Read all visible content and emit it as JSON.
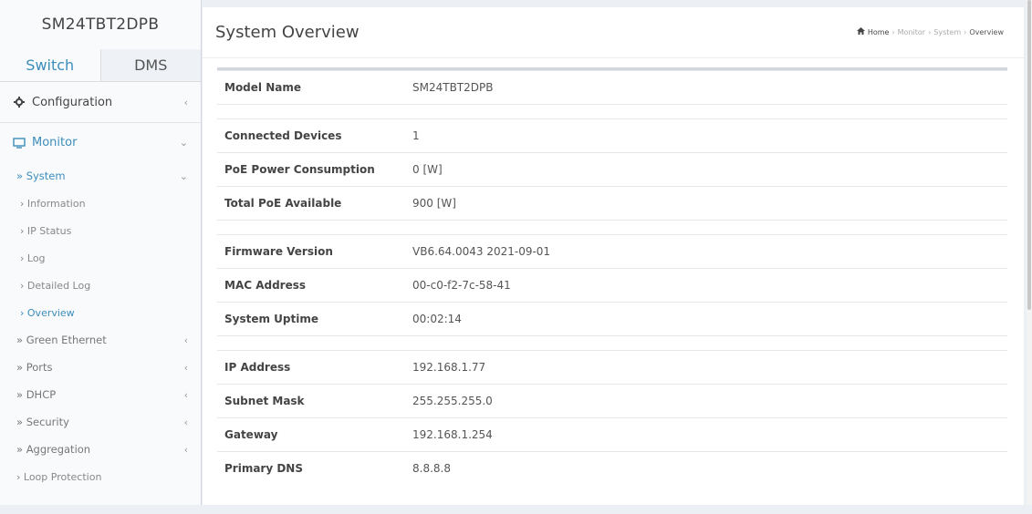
{
  "sidebar": {
    "brand": "SM24TBT2DPB",
    "tabs": [
      {
        "label": "Switch"
      },
      {
        "label": "DMS"
      }
    ],
    "configuration_label": "Configuration",
    "monitor_label": "Monitor",
    "system_label": "» System",
    "system_items": [
      {
        "label": "› Information"
      },
      {
        "label": "› IP Status"
      },
      {
        "label": "› Log"
      },
      {
        "label": "› Detailed Log"
      },
      {
        "label": "› Overview"
      }
    ],
    "other_items": [
      {
        "label": "» Green Ethernet"
      },
      {
        "label": "» Ports"
      },
      {
        "label": "» DHCP"
      },
      {
        "label": "» Security"
      },
      {
        "label": "» Aggregation"
      }
    ],
    "loop_label": "› Loop Protection"
  },
  "header": {
    "title": "System Overview",
    "breadcrumb": {
      "home": "Home",
      "monitor": "Monitor",
      "system": "System",
      "current": "Overview",
      "sep": "›"
    }
  },
  "overview": {
    "model_name": {
      "label": "Model Name",
      "value": "SM24TBT2DPB"
    },
    "connected_devices": {
      "label": "Connected Devices",
      "value": "1"
    },
    "poe_power": {
      "label": "PoE Power Consumption",
      "value": "0 [W]"
    },
    "total_poe": {
      "label": "Total PoE Available",
      "value": "900 [W]"
    },
    "firmware": {
      "label": "Firmware Version",
      "value": "VB6.64.0043 2021-09-01"
    },
    "mac": {
      "label": "MAC Address",
      "value": "00-c0-f2-7c-58-41"
    },
    "uptime": {
      "label": "System Uptime",
      "value": "00:02:14"
    },
    "ip": {
      "label": "IP Address",
      "value": "192.168.1.77"
    },
    "subnet": {
      "label": "Subnet Mask",
      "value": "255.255.255.0"
    },
    "gateway": {
      "label": "Gateway",
      "value": "192.168.1.254"
    },
    "dns": {
      "label": "Primary DNS",
      "value": "8.8.8.8"
    }
  },
  "colors": {
    "accent": "#3c8dbc",
    "text": "#444444"
  }
}
